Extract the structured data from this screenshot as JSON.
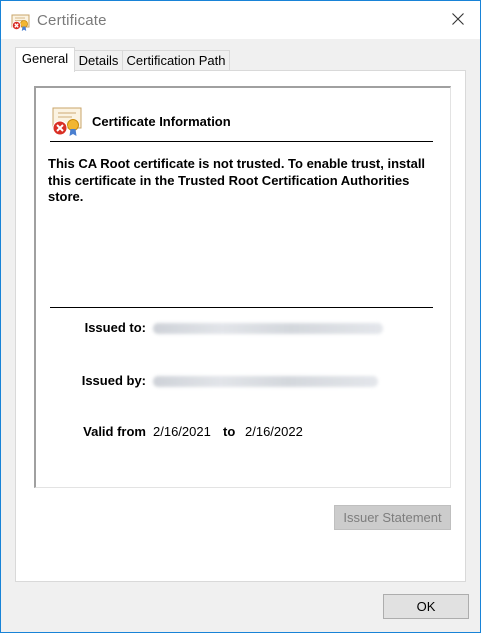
{
  "window": {
    "title": "Certificate",
    "border_color": "#1883d7"
  },
  "tabs": [
    {
      "label": "General",
      "active": true
    },
    {
      "label": "Details",
      "active": false
    },
    {
      "label": "Certification Path",
      "active": false
    }
  ],
  "general": {
    "heading": "Certificate Information",
    "trust_message": "This CA Root certificate is not trusted. To enable trust, install this certificate in the Trusted Root Certification Authorities store.",
    "issued_to_label": "Issued to:",
    "issued_by_label": "Issued by:",
    "valid_from_label": "Valid from",
    "valid_from": "2/16/2021",
    "to_label": "to",
    "valid_to": "2/16/2022"
  },
  "buttons": {
    "issuer_statement": "Issuer Statement",
    "ok": "OK"
  },
  "icons": {
    "title": "certificate-warning-icon",
    "info": "certificate-warning-icon",
    "close": "close-icon"
  }
}
